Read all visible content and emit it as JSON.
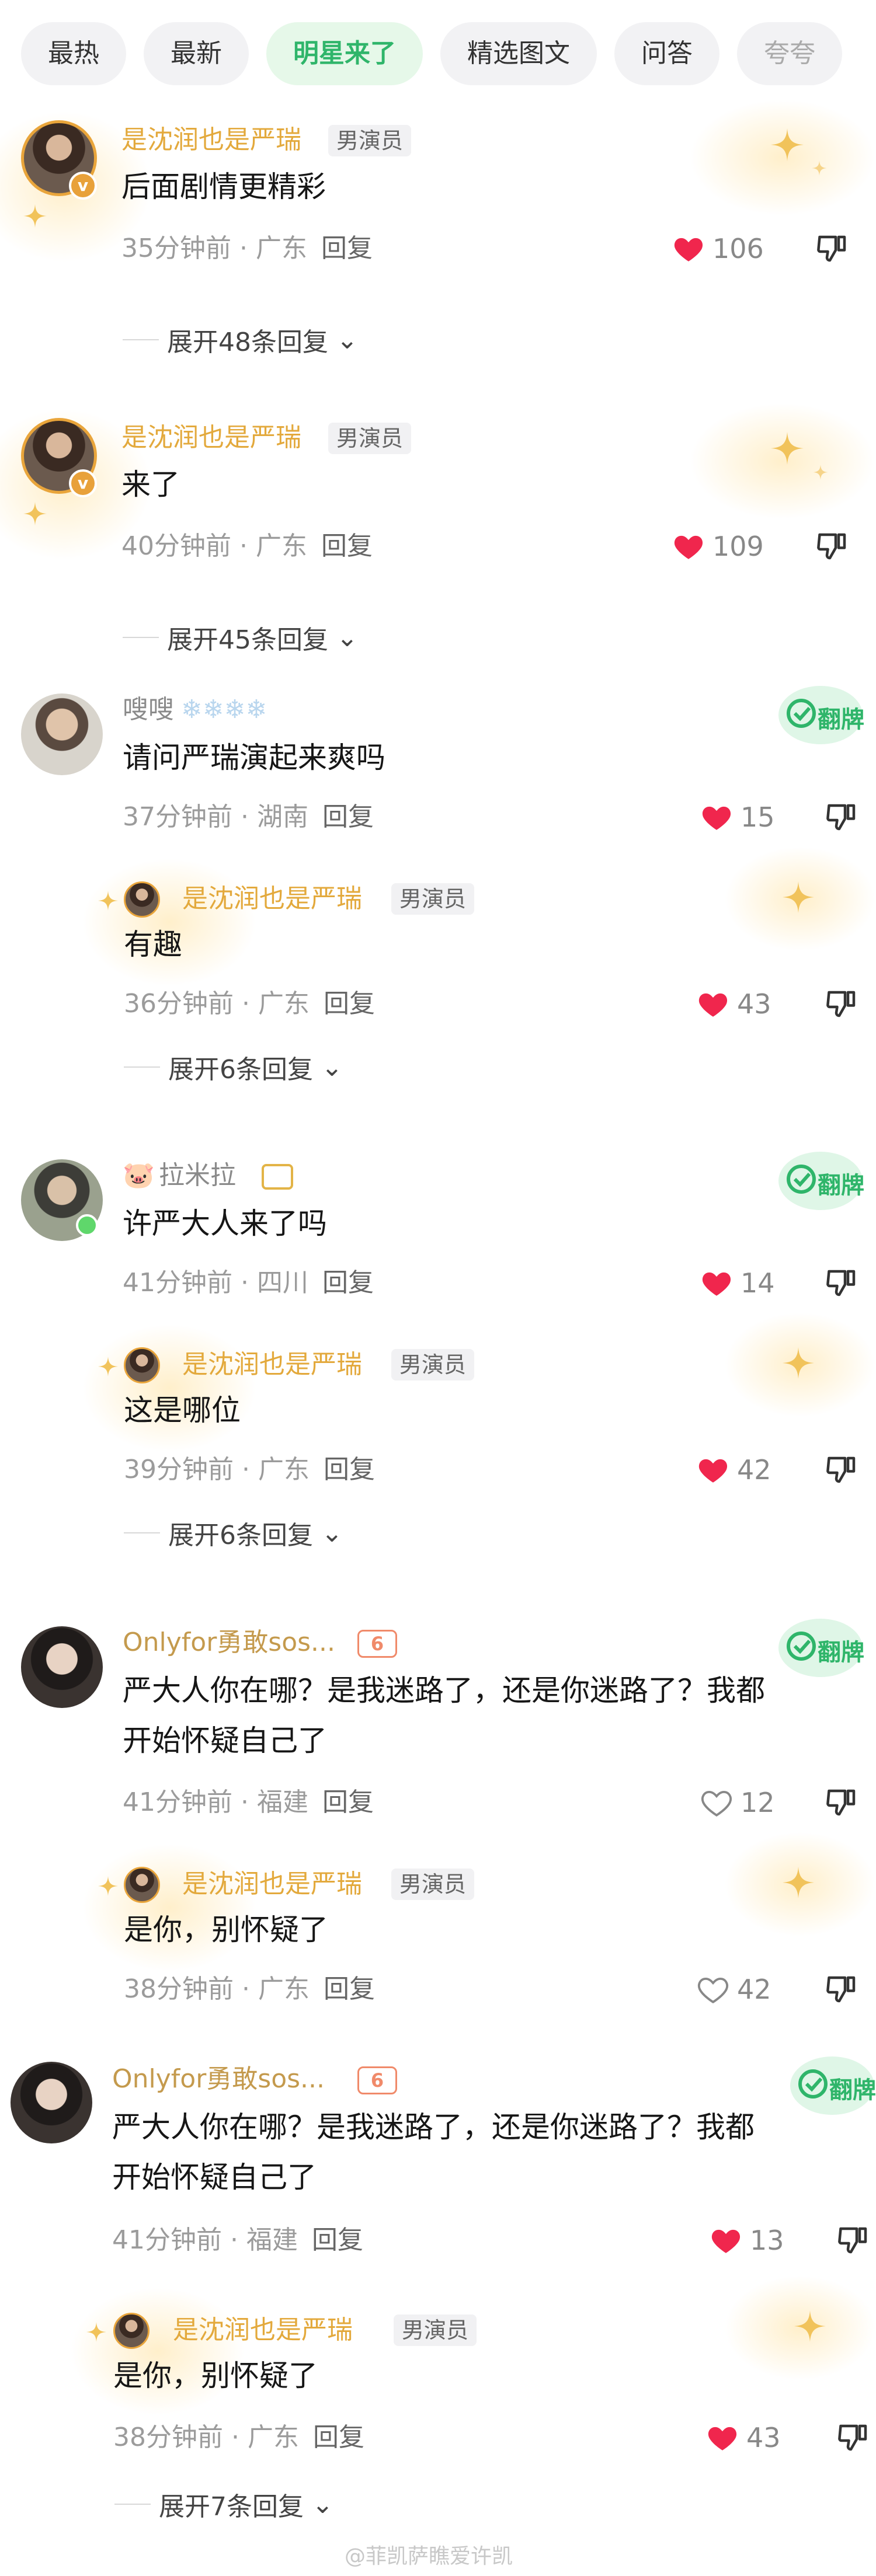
{
  "tabs": [
    {
      "label": "最热"
    },
    {
      "label": "最新"
    },
    {
      "label": "明星来了"
    },
    {
      "label": "精选图文"
    },
    {
      "label": "问答"
    },
    {
      "label": "夸夸"
    }
  ],
  "labels": {
    "reply": "回复",
    "role": "男演员",
    "fan_badge": "翻牌"
  },
  "comments": [
    {
      "name": "是沈润也是严瑞",
      "text": "后面剧情更精彩",
      "time": "35分钟前",
      "loc": "广东",
      "likes": "106",
      "expand": "展开48条回复"
    },
    {
      "name": "是沈润也是严瑞",
      "text": "来了",
      "time": "40分钟前",
      "loc": "广东",
      "likes": "109",
      "expand": "展开45条回复"
    },
    {
      "name": "嗖嗖",
      "text": "请问严瑞演起来爽吗",
      "time": "37分钟前",
      "loc": "湖南",
      "likes": "15",
      "reply": {
        "name": "是沈润也是严瑞",
        "text": "有趣",
        "time": "36分钟前",
        "loc": "广东",
        "likes": "43"
      },
      "expand": "展开6条回复"
    },
    {
      "name": "拉米拉",
      "text": "许严大人来了吗",
      "time": "41分钟前",
      "loc": "四川",
      "likes": "14",
      "reply": {
        "name": "是沈润也是严瑞",
        "text": "这是哪位",
        "time": "39分钟前",
        "loc": "广东",
        "likes": "42"
      },
      "expand": "展开6条回复"
    },
    {
      "name": "Onlyfor勇敢sos...",
      "level": "6",
      "line1": "严大人你在哪？是我迷路了，还是你迷路了？我都",
      "line2": "开始怀疑自己了",
      "time": "41分钟前",
      "loc": "福建",
      "likes": "12",
      "reply": {
        "name": "是沈润也是严瑞",
        "text": "是你，别怀疑了",
        "time": "38分钟前",
        "loc": "广东",
        "likes": "42"
      }
    },
    {
      "name": "Onlyfor勇敢sos...",
      "level": "6",
      "line1": "严大人你在哪？是我迷路了，还是你迷路了？我都",
      "line2": "开始怀疑自己了",
      "time": "41分钟前",
      "loc": "福建",
      "likes": "13",
      "reply": {
        "name": "是沈润也是严瑞",
        "text": "是你，别怀疑了",
        "time": "38分钟前",
        "loc": "广东",
        "likes": "43"
      },
      "expand": "展开7条回复"
    }
  ],
  "watermark": "@菲凯萨瞧爱许凯",
  "colors": {
    "gold": "#e3a93c",
    "like_red": "#f0264d",
    "green": "#2fb56a"
  }
}
